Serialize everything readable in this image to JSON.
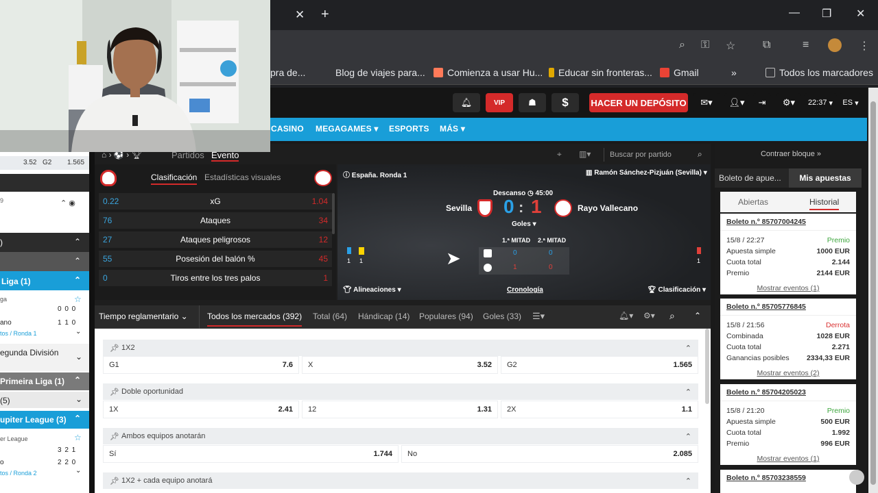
{
  "browser": {
    "bookmarks": [
      {
        "label": "pra de...",
        "color": "#888"
      },
      {
        "label": "Blog de viajes para...",
        "color": "#555"
      },
      {
        "label": "Comienza a usar Hu...",
        "color": "#ff7a59"
      },
      {
        "label": "Educar sin fronteras...",
        "color": "#e0a800"
      },
      {
        "label": "Gmail",
        "color": "#ea4335"
      },
      {
        "label": "Todos los marcadores",
        "color": "#888"
      }
    ],
    "bookmarks_more": "»"
  },
  "header": {
    "vip": "VIP",
    "dollar": "$",
    "deposit": "HACER UN DEPÓSITO",
    "time": "22:37",
    "lang": "ES"
  },
  "nav": [
    "CASINO",
    "MEGAGAMES",
    "ESPORTS",
    "MÁS"
  ],
  "left_panel": {
    "top_odds": {
      "x": "3.52",
      "g2label": "G2",
      "g2": "1.565"
    },
    "row_count": "9",
    "sections": [
      {
        "label": "Liga (1)",
        "style": "blue"
      },
      {
        "label": "ga",
        "style": "sub"
      },
      {
        "label": "ano",
        "scores": "1 1 0",
        "style": "team"
      },
      {
        "label": "tos / Ronda 1",
        "style": "link"
      },
      {
        "label": "egunda División",
        "style": "plain"
      },
      {
        "label": "Primeira Liga (1)",
        "style": "gray"
      },
      {
        "label": "(5)",
        "style": "light"
      },
      {
        "label": "upiter League (3)",
        "style": "blue"
      },
      {
        "label": "er League",
        "style": "sub"
      },
      {
        "label": "tos / Ronda 2",
        "style": "link"
      }
    ],
    "score_rows": [
      "0 0 0",
      "3 2 1",
      "2 2 0"
    ]
  },
  "crumb": {
    "partidos": "Partidos",
    "evento": "Evento",
    "search_placeholder": "Buscar por partido"
  },
  "stats": {
    "tabs": [
      "Clasificación",
      "Estadísticas visuales"
    ],
    "rows": [
      {
        "left": "0.22",
        "label": "xG",
        "right": "1.04"
      },
      {
        "left": "76",
        "label": "Ataques",
        "right": "34"
      },
      {
        "left": "27",
        "label": "Ataques peligrosos",
        "right": "12"
      },
      {
        "left": "55",
        "label": "Posesión del balón %",
        "right": "45"
      },
      {
        "left": "0",
        "label": "Tiros entre los tres palos",
        "right": "1"
      }
    ]
  },
  "scoreboard": {
    "round": "España. Ronda 1",
    "venue": "Ramón Sánchez-Pizjuán (Sevilla)",
    "status": "Descanso",
    "clock": "45:00",
    "home": "Sevilla",
    "away": "Rayo Vallecano",
    "home_score": "0",
    "away_score": "1",
    "separator": ":",
    "goals_label": "Goles",
    "half1": "1.ª MITAD",
    "half2": "2.ª MITAD",
    "home_h1": "0",
    "home_h2": "0",
    "away_h1": "1",
    "away_h2": "0",
    "left_flags": [
      "1",
      "1"
    ],
    "right_flag": "1",
    "lineups": "Alineaciones",
    "timeline": "Cronología",
    "standings": "Clasificación"
  },
  "market_tabs": {
    "period": "Tiempo reglamentario",
    "tabs": [
      "Todos los mercados (392)",
      "Total (64)",
      "Hándicap (14)",
      "Populares (94)",
      "Goles (33)"
    ]
  },
  "markets": [
    {
      "title": "1X2",
      "odds": [
        {
          "label": "G1",
          "value": "7.6"
        },
        {
          "label": "X",
          "value": "3.52"
        },
        {
          "label": "G2",
          "value": "1.565"
        }
      ]
    },
    {
      "title": "Doble oportunidad",
      "odds": [
        {
          "label": "1X",
          "value": "2.41"
        },
        {
          "label": "12",
          "value": "1.31"
        },
        {
          "label": "2X",
          "value": "1.1"
        }
      ]
    },
    {
      "title": "Ambos equipos anotarán",
      "odds": [
        {
          "label": "Sí",
          "value": "1.744"
        },
        {
          "label": "No",
          "value": "2.085"
        }
      ]
    },
    {
      "title": "1X2 + cada equipo anotará",
      "odds": []
    }
  ],
  "right_panel": {
    "collapse": "Contraer bloque »",
    "tabs": [
      "Boleto de apue...",
      "Mis apuestas"
    ],
    "subtabs": [
      "Abiertas",
      "Historial"
    ],
    "bets": [
      {
        "id": "Boleto n.º 85707004245",
        "date": "15/8 / 22:27",
        "result": "Premio",
        "result_color": "#3ca53c",
        "type": "Apuesta simple",
        "stake": "1000 EUR",
        "odds_label": "Cuota total",
        "odds": "2.144",
        "prize_label": "Premio",
        "prize": "2144 EUR",
        "show": "Mostrar eventos (1)"
      },
      {
        "id": "Boleto n.º 85705776845",
        "date": "15/8 / 21:56",
        "result": "Derrota",
        "result_color": "#d93030",
        "type": "Combinada",
        "stake": "1028 EUR",
        "odds_label": "Cuota total",
        "odds": "2.271",
        "prize_label": "Ganancias posibles",
        "prize": "2334,33 EUR",
        "show": "Mostrar eventos (2)"
      },
      {
        "id": "Boleto n.º 85704205023",
        "date": "15/8 / 21:20",
        "result": "Premio",
        "result_color": "#3ca53c",
        "type": "Apuesta simple",
        "stake": "500 EUR",
        "odds_label": "Cuota total",
        "odds": "1.992",
        "prize_label": "Premio",
        "prize": "996 EUR",
        "show": "Mostrar eventos (1)"
      },
      {
        "id": "Boleto n.º 85703238559"
      }
    ]
  }
}
